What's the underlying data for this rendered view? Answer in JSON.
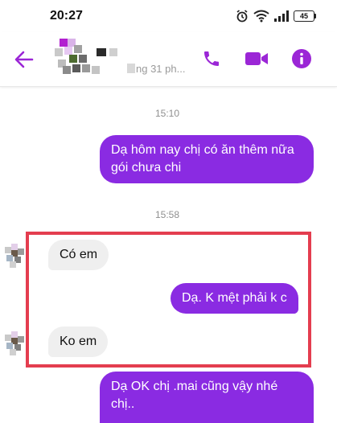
{
  "status_bar": {
    "time": "20:27",
    "battery": "45"
  },
  "header": {
    "last_active": "ng 31 ph..."
  },
  "icons": {
    "back": "back-arrow-icon",
    "call": "phone-icon",
    "video": "video-camera-icon",
    "info": "info-icon"
  },
  "colors": {
    "accent": "#9b26d6",
    "outgoing_bubble": "#8a2be2",
    "incoming_bubble": "#efefef",
    "highlight_box": "#e43d4f"
  },
  "messages": {
    "timestamp_1": "15:10",
    "out_1": "Dạ hôm nay chị có ăn thêm nữa gói chưa chi",
    "timestamp_2": "15:58",
    "in_1": "Có em",
    "out_2": "Dạ. K mệt phải k c",
    "in_2": "Ko em",
    "out_3": "Dạ OK chị .mai cũng vậy nhé chị.."
  }
}
